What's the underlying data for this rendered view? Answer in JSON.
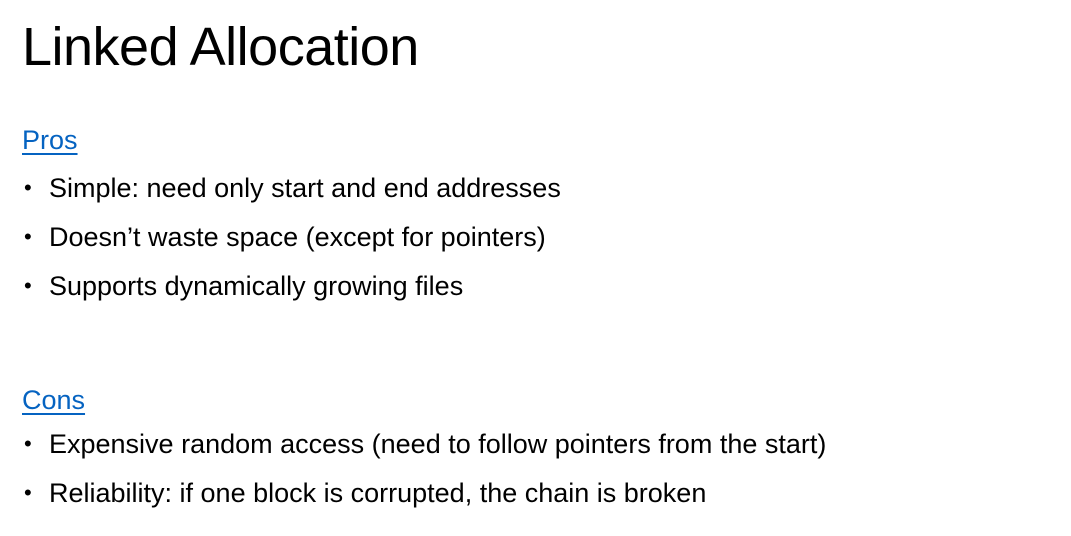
{
  "slide": {
    "title": "Linked Allocation",
    "heading_color": "#0563C1",
    "text_color": "#000000",
    "background": "#ffffff",
    "pros": {
      "heading": "Pros",
      "items": [
        "Simple: need only start and end addresses",
        "Doesn’t waste space (except for pointers)",
        "Supports dynamically growing files"
      ]
    },
    "cons": {
      "heading": "Cons",
      "items": [
        "Expensive random access (need to follow pointers from the start)",
        "Reliability: if one block is corrupted, the chain is broken"
      ]
    }
  }
}
